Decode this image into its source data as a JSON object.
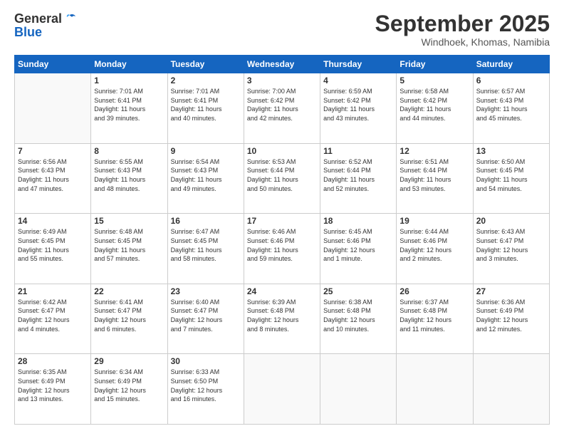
{
  "header": {
    "logo_general": "General",
    "logo_blue": "Blue",
    "month": "September 2025",
    "location": "Windhoek, Khomas, Namibia"
  },
  "days_of_week": [
    "Sunday",
    "Monday",
    "Tuesday",
    "Wednesday",
    "Thursday",
    "Friday",
    "Saturday"
  ],
  "weeks": [
    [
      {
        "day": "",
        "info": ""
      },
      {
        "day": "1",
        "info": "Sunrise: 7:01 AM\nSunset: 6:41 PM\nDaylight: 11 hours\nand 39 minutes."
      },
      {
        "day": "2",
        "info": "Sunrise: 7:01 AM\nSunset: 6:41 PM\nDaylight: 11 hours\nand 40 minutes."
      },
      {
        "day": "3",
        "info": "Sunrise: 7:00 AM\nSunset: 6:42 PM\nDaylight: 11 hours\nand 42 minutes."
      },
      {
        "day": "4",
        "info": "Sunrise: 6:59 AM\nSunset: 6:42 PM\nDaylight: 11 hours\nand 43 minutes."
      },
      {
        "day": "5",
        "info": "Sunrise: 6:58 AM\nSunset: 6:42 PM\nDaylight: 11 hours\nand 44 minutes."
      },
      {
        "day": "6",
        "info": "Sunrise: 6:57 AM\nSunset: 6:43 PM\nDaylight: 11 hours\nand 45 minutes."
      }
    ],
    [
      {
        "day": "7",
        "info": "Sunrise: 6:56 AM\nSunset: 6:43 PM\nDaylight: 11 hours\nand 47 minutes."
      },
      {
        "day": "8",
        "info": "Sunrise: 6:55 AM\nSunset: 6:43 PM\nDaylight: 11 hours\nand 48 minutes."
      },
      {
        "day": "9",
        "info": "Sunrise: 6:54 AM\nSunset: 6:43 PM\nDaylight: 11 hours\nand 49 minutes."
      },
      {
        "day": "10",
        "info": "Sunrise: 6:53 AM\nSunset: 6:44 PM\nDaylight: 11 hours\nand 50 minutes."
      },
      {
        "day": "11",
        "info": "Sunrise: 6:52 AM\nSunset: 6:44 PM\nDaylight: 11 hours\nand 52 minutes."
      },
      {
        "day": "12",
        "info": "Sunrise: 6:51 AM\nSunset: 6:44 PM\nDaylight: 11 hours\nand 53 minutes."
      },
      {
        "day": "13",
        "info": "Sunrise: 6:50 AM\nSunset: 6:45 PM\nDaylight: 11 hours\nand 54 minutes."
      }
    ],
    [
      {
        "day": "14",
        "info": "Sunrise: 6:49 AM\nSunset: 6:45 PM\nDaylight: 11 hours\nand 55 minutes."
      },
      {
        "day": "15",
        "info": "Sunrise: 6:48 AM\nSunset: 6:45 PM\nDaylight: 11 hours\nand 57 minutes."
      },
      {
        "day": "16",
        "info": "Sunrise: 6:47 AM\nSunset: 6:45 PM\nDaylight: 11 hours\nand 58 minutes."
      },
      {
        "day": "17",
        "info": "Sunrise: 6:46 AM\nSunset: 6:46 PM\nDaylight: 11 hours\nand 59 minutes."
      },
      {
        "day": "18",
        "info": "Sunrise: 6:45 AM\nSunset: 6:46 PM\nDaylight: 12 hours\nand 1 minute."
      },
      {
        "day": "19",
        "info": "Sunrise: 6:44 AM\nSunset: 6:46 PM\nDaylight: 12 hours\nand 2 minutes."
      },
      {
        "day": "20",
        "info": "Sunrise: 6:43 AM\nSunset: 6:47 PM\nDaylight: 12 hours\nand 3 minutes."
      }
    ],
    [
      {
        "day": "21",
        "info": "Sunrise: 6:42 AM\nSunset: 6:47 PM\nDaylight: 12 hours\nand 4 minutes."
      },
      {
        "day": "22",
        "info": "Sunrise: 6:41 AM\nSunset: 6:47 PM\nDaylight: 12 hours\nand 6 minutes."
      },
      {
        "day": "23",
        "info": "Sunrise: 6:40 AM\nSunset: 6:47 PM\nDaylight: 12 hours\nand 7 minutes."
      },
      {
        "day": "24",
        "info": "Sunrise: 6:39 AM\nSunset: 6:48 PM\nDaylight: 12 hours\nand 8 minutes."
      },
      {
        "day": "25",
        "info": "Sunrise: 6:38 AM\nSunset: 6:48 PM\nDaylight: 12 hours\nand 10 minutes."
      },
      {
        "day": "26",
        "info": "Sunrise: 6:37 AM\nSunset: 6:48 PM\nDaylight: 12 hours\nand 11 minutes."
      },
      {
        "day": "27",
        "info": "Sunrise: 6:36 AM\nSunset: 6:49 PM\nDaylight: 12 hours\nand 12 minutes."
      }
    ],
    [
      {
        "day": "28",
        "info": "Sunrise: 6:35 AM\nSunset: 6:49 PM\nDaylight: 12 hours\nand 13 minutes."
      },
      {
        "day": "29",
        "info": "Sunrise: 6:34 AM\nSunset: 6:49 PM\nDaylight: 12 hours\nand 15 minutes."
      },
      {
        "day": "30",
        "info": "Sunrise: 6:33 AM\nSunset: 6:50 PM\nDaylight: 12 hours\nand 16 minutes."
      },
      {
        "day": "",
        "info": ""
      },
      {
        "day": "",
        "info": ""
      },
      {
        "day": "",
        "info": ""
      },
      {
        "day": "",
        "info": ""
      }
    ]
  ]
}
